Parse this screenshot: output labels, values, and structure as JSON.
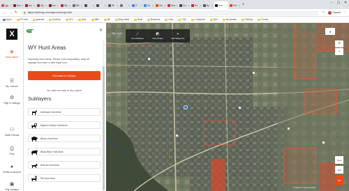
{
  "browser": {
    "tabs": [
      {
        "label": "Igg",
        "color": "#e34b4b"
      },
      {
        "label": "Bov",
        "color": "#8a1c1c"
      },
      {
        "label": "Ani",
        "color": "#b31217"
      },
      {
        "label": "Wy",
        "color": "#c62828"
      },
      {
        "label": "Arc",
        "color": "#7d1f1f"
      },
      {
        "label": "Wy",
        "color": "#c62828"
      },
      {
        "label": "BB",
        "color": "#6b6b6b"
      },
      {
        "label": "",
        "color": "#4a4a4a"
      },
      {
        "label": "",
        "color": "#4a4a4a"
      },
      {
        "label": "Wi",
        "color": "#5c5c5c"
      },
      {
        "label": "",
        "color": "#777"
      },
      {
        "label": "G",
        "color": "#4285f4"
      },
      {
        "label": "Go",
        "color": "#4285f4"
      },
      {
        "label": "Sel",
        "color": "#e65100"
      },
      {
        "label": "Sea",
        "color": "#d32f2f"
      },
      {
        "label": "Gu",
        "color": "#444"
      },
      {
        "label": "Ho",
        "color": "#c62828"
      },
      {
        "label": "Bo",
        "color": "#555"
      },
      {
        "label": "onX",
        "color": "#111",
        "active": true
      },
      {
        "label": "Sor",
        "color": "#e94b1e"
      }
    ],
    "newtab": "+",
    "url": "https://webmap.onxmaps.com/hunt/map#8.35/44.8141/-106.9636",
    "url_display": "https://webmap.onxmaps.com/map.html",
    "paused_label": "Paused",
    "bookmarks": [
      "Apps",
      "FS mail",
      "podcast",
      "Archery",
      "ATV",
      "Auto",
      "BB2",
      "Bk",
      "Blog ideas",
      "Boat",
      "Business",
      "Cars",
      "CNC",
      "Computer",
      "Diet",
      "elk jewelry",
      "Fishing",
      "Forrest"
    ]
  },
  "rail": {
    "logo": "X",
    "items": [
      {
        "label": "Map Layers",
        "icon": "layers-icon",
        "glyph": "◈",
        "active": true
      },
      {
        "label": "My Content",
        "icon": "content-icon",
        "glyph": "☰"
      },
      {
        "label": "Help & Settings",
        "icon": "gear-icon",
        "glyph": "⚙"
      },
      {
        "label": "Invite Friends",
        "icon": "invite-icon",
        "glyph": "⚇"
      },
      {
        "label": "Print",
        "icon": "print-icon",
        "glyph": "⎙"
      },
      {
        "label": "Profile & Account",
        "icon": "profile-icon",
        "glyph": "●"
      },
      {
        "label": "Chg Updates",
        "icon": "updates-icon",
        "glyph": "▣"
      }
    ]
  },
  "panel": {
    "toggle_label": "ON",
    "title": "WY Hunt Areas",
    "description": "Wyoming Hunt Areas. Please hunt responsibly, obey all signage and have a safe legal hunt.",
    "primary_button": "Put back in Library",
    "take_link": "No, take me back to My Layers",
    "sublayers_title": "Sublayers",
    "sublayers": [
      {
        "label": "Antelope Hunt Area",
        "icon": "antelope-icon"
      },
      {
        "label": "Bighorn Sheep Hunt Area",
        "icon": "bighorn-sheep-icon"
      },
      {
        "label": "Bison Hunt Area",
        "icon": "bison-icon"
      },
      {
        "label": "Black Bear Hunt Area",
        "icon": "bear-icon"
      },
      {
        "label": "Bobcat Hunt Area",
        "icon": "bobcat-icon"
      },
      {
        "label": "Elk Hunt Area",
        "icon": "elk-icon"
      }
    ]
  },
  "map": {
    "tools_label": "Map Tools",
    "tools": [
      {
        "label": "Line Distance",
        "icon": "ruler-icon",
        "glyph": "⟋"
      },
      {
        "label": "Area Shape",
        "icon": "area-icon",
        "glyph": "◩"
      },
      {
        "label": "Add Waypoint",
        "icon": "waypoint-icon",
        "glyph": "⌖"
      }
    ],
    "compass": "N",
    "zoom_in": "+",
    "zoom_out": "−",
    "layer_styles": [
      "Topo",
      "Hyb",
      "Sat"
    ],
    "attribution": "© Mapbox © OpenStreetMap"
  },
  "colors": {
    "accent": "#ea4a1a",
    "toggle_green": "#2e9e3e",
    "hunt_area_border": "#e2563a"
  }
}
